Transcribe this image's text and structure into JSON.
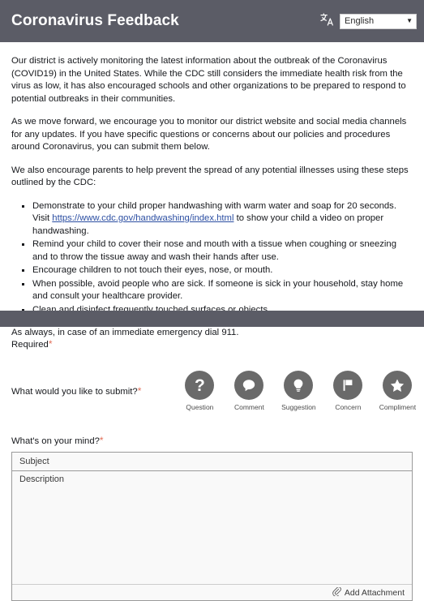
{
  "header": {
    "title": "Coronavirus Feedback",
    "translate_icon": "translate-icon",
    "language_value": "English",
    "caret": "▼"
  },
  "content": {
    "paragraph_1": "Our district is actively monitoring the latest information about the outbreak of the Coronavirus (COVID19) in the United States. While the CDC still considers the immediate health risk from the virus as low, it has also encouraged schools and other organizations to be prepared to respond to potential outbreaks in their communities.",
    "paragraph_2": "As we move forward, we encourage you to monitor our district website and social media channels for any updates. If you have specific questions or concerns about our policies and procedures around Coronavirus, you can submit them below.",
    "paragraph_3": "We also encourage parents to help prevent the spread of any potential illnesses using these steps outlined by the CDC:",
    "bullet_1_before": "Demonstrate to your child proper handwashing with warm water and soap for 20 seconds. Visit ",
    "bullet_1_link": "https://www.cdc.gov/handwashing/index.html",
    "bullet_1_after": " to show your child a video on proper handwashing.",
    "bullet_2": "Remind your child to cover their nose and mouth with a tissue when coughing or sneezing and to throw the tissue away and wash their hands after use.",
    "bullet_3": "Encourage children to not touch their eyes, nose, or mouth.",
    "bullet_4": "When possible, avoid people who are sick. If someone is sick in your household, stay home and consult your healthcare provider.",
    "bullet_5": "Clean and disinfect frequently touched surfaces or objects.",
    "paragraph_4": "As always, in case of an immediate emergency dial 911."
  },
  "form": {
    "required_label": "Required",
    "required_marker": "*",
    "submit_question": "What would you like to submit?",
    "submit_marker": "*",
    "types": [
      {
        "label": "Question",
        "icon": "question-mark-icon"
      },
      {
        "label": "Comment",
        "icon": "speech-bubble-icon"
      },
      {
        "label": "Suggestion",
        "icon": "lightbulb-icon"
      },
      {
        "label": "Concern",
        "icon": "flag-icon"
      },
      {
        "label": "Compliment",
        "icon": "star-icon"
      }
    ],
    "mind_question": "What's on your mind?",
    "mind_marker": "*",
    "subject_placeholder": "Subject",
    "subject_value": "",
    "description_placeholder": "Description",
    "description_value": "",
    "attachment_label": "Add Attachment",
    "attachment_icon": "paperclip-icon"
  },
  "colors": {
    "band": "#5b5c66",
    "required_marker": "#e2705a",
    "link": "#2b4ea2",
    "icon_circle": "#6a6a6a"
  }
}
